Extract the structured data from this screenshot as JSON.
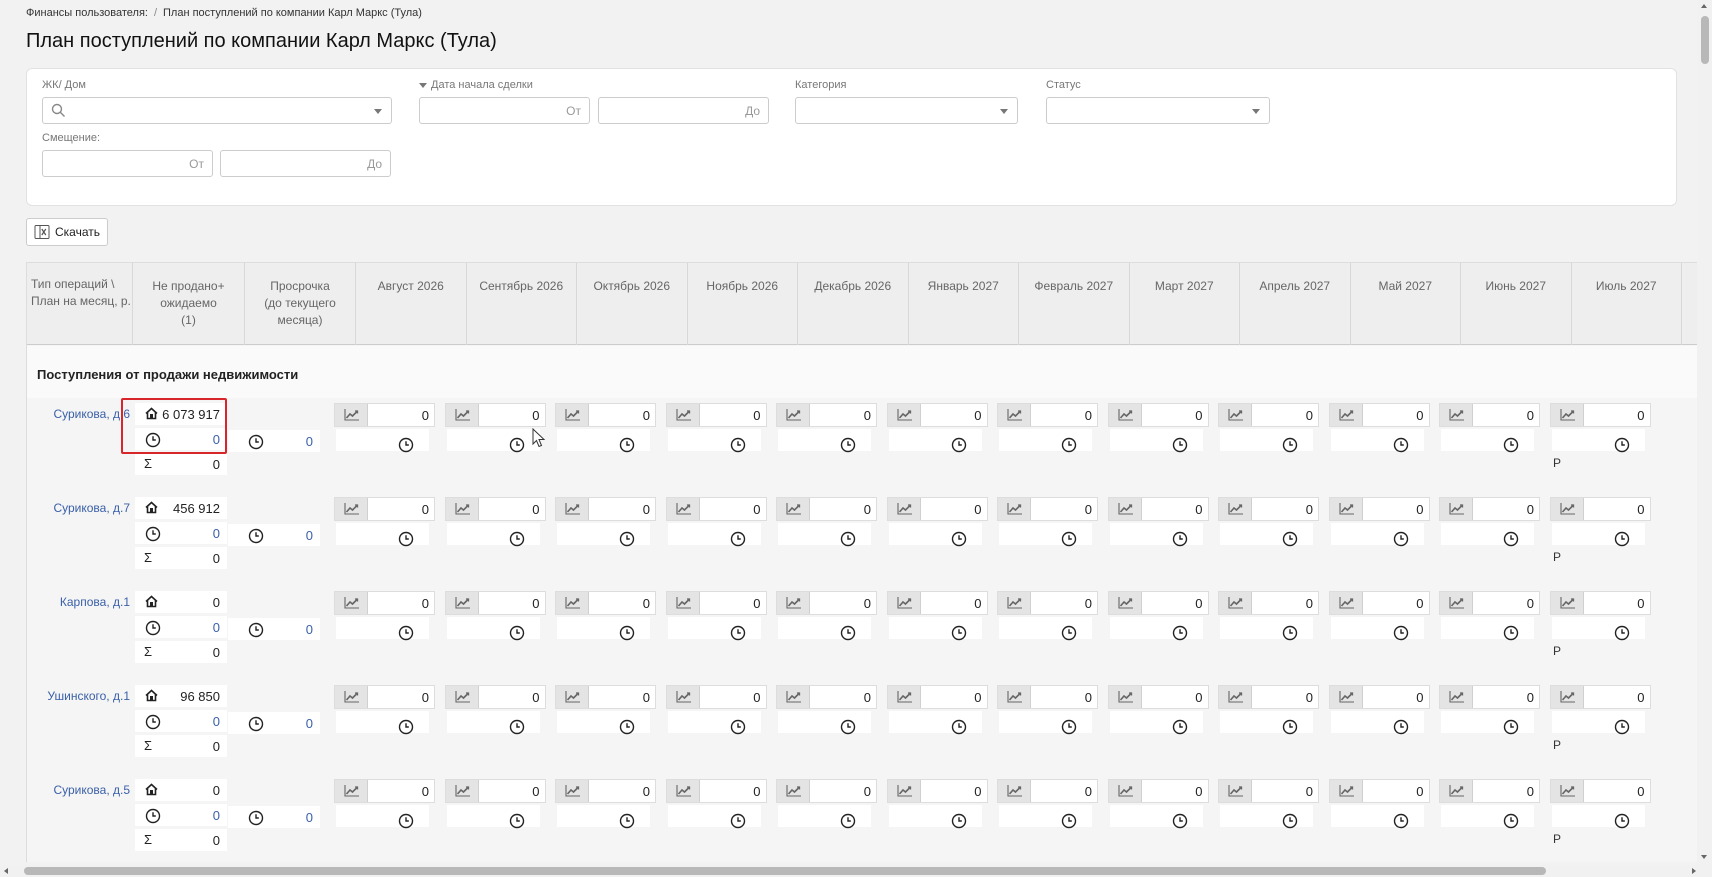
{
  "breadcrumb": {
    "items": [
      "Финансы пользователя:",
      "План поступлений по компании Карл Маркс (Тула)"
    ],
    "separator": "/"
  },
  "page_title": "План поступлений по компании Карл Маркс (Тула)",
  "filters": {
    "complex_label": "ЖК/ Дом",
    "deal_start_label": "Дата начала сделки",
    "from_placeholder": "От",
    "to_placeholder": "До",
    "category_label": "Категория",
    "status_label": "Статус",
    "offset_label": "Смещение:"
  },
  "toolbar": {
    "download_label": "Скачать"
  },
  "table": {
    "col_type_line1": "Тип операций \\",
    "col_type_line2": "План на месяц, р.",
    "col_unsold_line1": "Не продано+",
    "col_unsold_line2": "ожидаемо",
    "col_unsold_line3": "(1)",
    "col_overdue_line1": "Просрочка",
    "col_overdue_line2": "(до текущего",
    "col_overdue_line3": "месяца)",
    "months": [
      "Август 2026",
      "Сентябрь 2026",
      "Октябрь 2026",
      "Ноябрь 2026",
      "Декабрь 2026",
      "Январь 2027",
      "Февраль 2027",
      "Март 2027",
      "Апрель 2027",
      "Май 2027",
      "Июнь 2027",
      "Июль 2027"
    ],
    "section_title": "Поступления от продажи недвижимости",
    "sum_symbol": "Σ",
    "right_mark": "Р",
    "rows": [
      {
        "name": "Сурикова, д.6",
        "unsold": "6 073 917",
        "expected": "0",
        "sum": "0",
        "overdue": "0",
        "monthly": [
          "0",
          "0",
          "0",
          "0",
          "0",
          "0",
          "0",
          "0",
          "0",
          "0",
          "0",
          "0"
        ]
      },
      {
        "name": "Сурикова, д.7",
        "unsold": "456 912",
        "expected": "0",
        "sum": "0",
        "overdue": "0",
        "monthly": [
          "0",
          "0",
          "0",
          "0",
          "0",
          "0",
          "0",
          "0",
          "0",
          "0",
          "0",
          "0"
        ]
      },
      {
        "name": "Карпова, д.1",
        "unsold": "0",
        "expected": "0",
        "sum": "0",
        "overdue": "0",
        "monthly": [
          "0",
          "0",
          "0",
          "0",
          "0",
          "0",
          "0",
          "0",
          "0",
          "0",
          "0",
          "0"
        ]
      },
      {
        "name": "Ушинского, д.1",
        "unsold": "96 850",
        "expected": "0",
        "sum": "0",
        "overdue": "0",
        "monthly": [
          "0",
          "0",
          "0",
          "0",
          "0",
          "0",
          "0",
          "0",
          "0",
          "0",
          "0",
          "0"
        ]
      },
      {
        "name": "Сурикова, д.5",
        "unsold": "0",
        "expected": "0",
        "sum": "0",
        "overdue": "0",
        "monthly": [
          "0",
          "0",
          "0",
          "0",
          "0",
          "0",
          "0",
          "0",
          "0",
          "0",
          "0",
          "0"
        ]
      }
    ]
  },
  "colors": {
    "accent_link": "#3a60a8",
    "selection_border": "#d9262a"
  },
  "icons": {
    "house": "house-icon",
    "clock": "clock-icon",
    "chart": "chart-icon",
    "search": "search-icon",
    "excel": "excel-icon"
  }
}
